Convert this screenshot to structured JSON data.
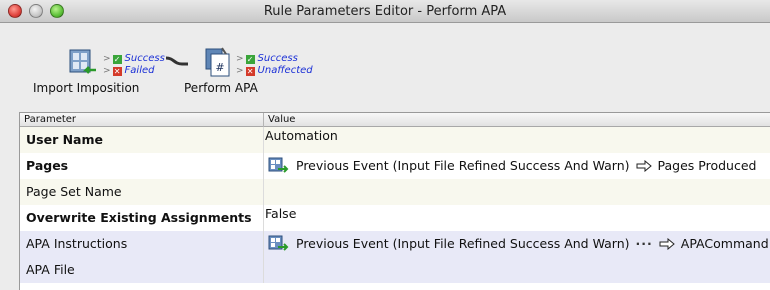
{
  "window": {
    "title": "Rule Parameters Editor - Perform APA"
  },
  "workflow": {
    "nodes": [
      {
        "label": "Import Imposition",
        "branches": [
          {
            "status": "ok",
            "label": "Success"
          },
          {
            "status": "fail",
            "label": "Failed"
          }
        ]
      },
      {
        "label": "Perform APA",
        "branches": [
          {
            "status": "ok",
            "label": "Success"
          },
          {
            "status": "fail",
            "label": "Unaffected"
          }
        ]
      }
    ]
  },
  "table": {
    "headers": {
      "parameter": "Parameter",
      "value": "Value"
    },
    "rows": [
      {
        "parameter": "User Name",
        "value": "Automation"
      },
      {
        "parameter": "Pages",
        "event": "Previous Event (Input File Refined Success And Warn)",
        "target": "Pages Produced"
      },
      {
        "parameter": "Page Set Name",
        "value": ""
      },
      {
        "parameter": "Overwrite Existing Assignments",
        "value": "False"
      },
      {
        "parameter": "APA Instructions",
        "event": "Previous Event (Input File Refined Success And Warn)",
        "ellipsis": "···",
        "target": "APACommand"
      },
      {
        "parameter": "APA File",
        "value": ""
      }
    ]
  },
  "colors": {
    "branch_text": "#1a2fd6",
    "success_mark": "#3aa53a",
    "failed_mark": "#d43a2a",
    "selected_row": "#e8e9f7"
  }
}
